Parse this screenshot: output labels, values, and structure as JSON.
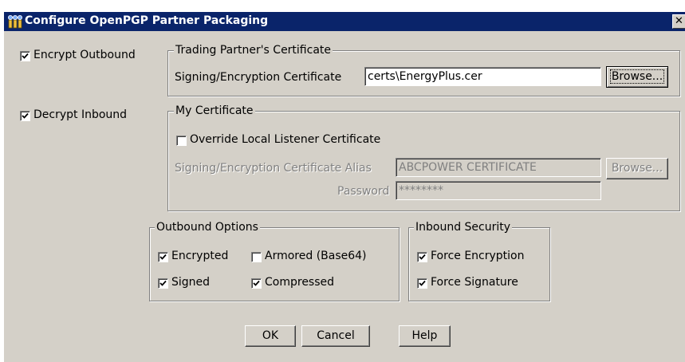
{
  "window": {
    "title": "Configure OpenPGP Partner Packaging",
    "close_symbol": "✕"
  },
  "encrypt_outbound": {
    "label": "Encrypt Outbound",
    "checked": true
  },
  "decrypt_inbound": {
    "label": "Decrypt Inbound",
    "checked": true
  },
  "trading_partner_certificate": {
    "legend": "Trading Partner's Certificate",
    "signing_label": "Signing/Encryption Certificate",
    "signing_value": "certs\\EnergyPlus.cer",
    "browse_label": "Browse..."
  },
  "my_certificate": {
    "legend": "My Certificate",
    "override_label": "Override Local Listener Certificate",
    "override_checked": false,
    "alias_label": "Signing/Encryption Certificate Alias",
    "alias_value": "ABCPOWER CERTIFICATE",
    "browse_label": "Browse...",
    "password_label": "Password",
    "password_value": "********"
  },
  "outbound_options": {
    "legend": "Outbound Options",
    "encrypted": {
      "label": "Encrypted",
      "checked": true
    },
    "armored": {
      "label": "Armored (Base64)",
      "checked": false
    },
    "signed": {
      "label": "Signed",
      "checked": true
    },
    "compressed": {
      "label": "Compressed",
      "checked": true
    }
  },
  "inbound_security": {
    "legend": "Inbound Security",
    "force_encryption": {
      "label": "Force Encryption",
      "checked": true
    },
    "force_signature": {
      "label": "Force Signature",
      "checked": true
    }
  },
  "buttons": {
    "ok": "OK",
    "cancel": "Cancel",
    "help": "Help"
  },
  "icons": {
    "title": "key-pair-icon",
    "check": "checkmark-icon"
  },
  "colors": {
    "face": "#d4d0c8",
    "titlebar": "#0a246a",
    "disabled_text": "#808080"
  }
}
